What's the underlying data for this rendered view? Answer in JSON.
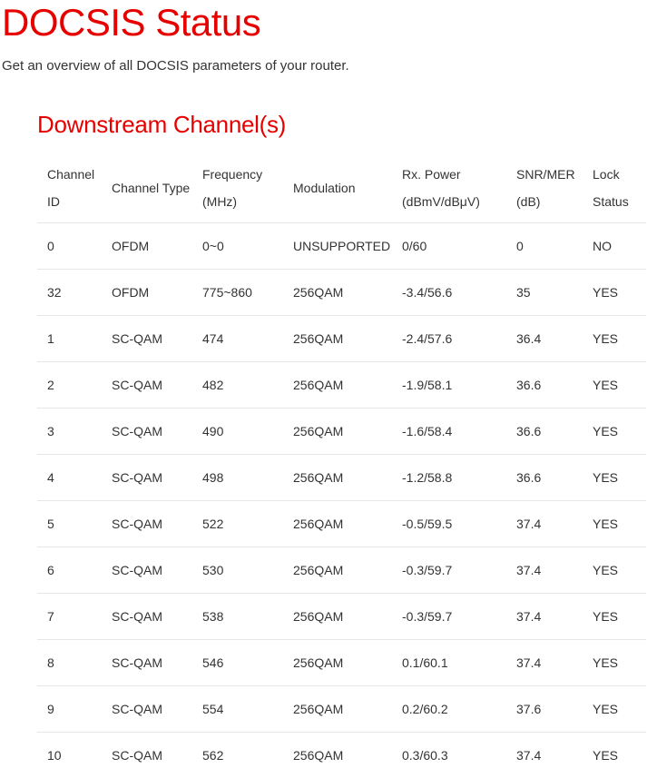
{
  "page": {
    "title": "DOCSIS Status",
    "subtitle": "Get an overview of all DOCSIS parameters of your router."
  },
  "downstream": {
    "title": "Downstream Channel(s)",
    "headers": [
      {
        "line1": "Channel",
        "line2": "ID"
      },
      {
        "line1": "Channel Type",
        "line2": ""
      },
      {
        "line1": "Frequency",
        "line2": "(MHz)"
      },
      {
        "line1": "Modulation",
        "line2": ""
      },
      {
        "line1": "Rx. Power",
        "line2": "(dBmV/dBμV)"
      },
      {
        "line1": "SNR/MER",
        "line2": "(dB)"
      },
      {
        "line1": "Lock",
        "line2": "Status"
      }
    ],
    "rows": [
      [
        "0",
        "OFDM",
        "0~0",
        "UNSUPPORTED",
        "0/60",
        "0",
        "NO"
      ],
      [
        "32",
        "OFDM",
        "775~860",
        "256QAM",
        "-3.4/56.6",
        "35",
        "YES"
      ],
      [
        "1",
        "SC-QAM",
        "474",
        "256QAM",
        "-2.4/57.6",
        "36.4",
        "YES"
      ],
      [
        "2",
        "SC-QAM",
        "482",
        "256QAM",
        "-1.9/58.1",
        "36.6",
        "YES"
      ],
      [
        "3",
        "SC-QAM",
        "490",
        "256QAM",
        "-1.6/58.4",
        "36.6",
        "YES"
      ],
      [
        "4",
        "SC-QAM",
        "498",
        "256QAM",
        "-1.2/58.8",
        "36.6",
        "YES"
      ],
      [
        "5",
        "SC-QAM",
        "522",
        "256QAM",
        "-0.5/59.5",
        "37.4",
        "YES"
      ],
      [
        "6",
        "SC-QAM",
        "530",
        "256QAM",
        "-0.3/59.7",
        "37.4",
        "YES"
      ],
      [
        "7",
        "SC-QAM",
        "538",
        "256QAM",
        "-0.3/59.7",
        "37.4",
        "YES"
      ],
      [
        "8",
        "SC-QAM",
        "546",
        "256QAM",
        "0.1/60.1",
        "37.4",
        "YES"
      ],
      [
        "9",
        "SC-QAM",
        "554",
        "256QAM",
        "0.2/60.2",
        "37.6",
        "YES"
      ],
      [
        "10",
        "SC-QAM",
        "562",
        "256QAM",
        "0.3/60.3",
        "37.4",
        "YES"
      ]
    ]
  },
  "colors": {
    "accent": "#e60000",
    "text": "#333333",
    "divider": "#e6e6e6"
  }
}
